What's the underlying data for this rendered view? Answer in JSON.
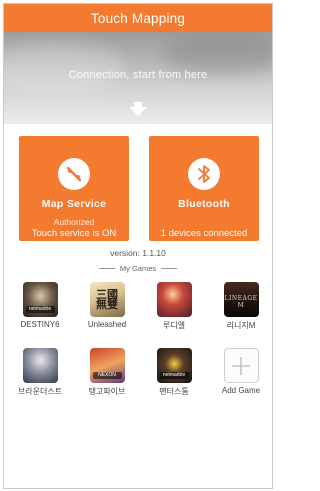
{
  "app": {
    "title": "Touch Mapping"
  },
  "hero": {
    "message": "Connection, start from here"
  },
  "tiles": {
    "map_service": {
      "name": "Map Service",
      "status": "Authorized",
      "detail": "Touch service is ON"
    },
    "bluetooth": {
      "name": "Bluetooth",
      "status": "",
      "detail": "1 devices connected"
    }
  },
  "version": "version: 1.1.10",
  "my_games": {
    "title": "My Games",
    "items": [
      {
        "label": "DESTINY6",
        "icon": "destiny6-game-icon",
        "icon_text": "netmarble"
      },
      {
        "label": "Unleashed",
        "icon": "unleashed-game-icon",
        "icon_text": "三國\n無雙"
      },
      {
        "label": "루디엘",
        "icon": "rudiel-game-icon",
        "icon_text": ""
      },
      {
        "label": "리니지M",
        "icon": "lineage-m-game-icon",
        "icon_text": "LINEAGE M"
      },
      {
        "label": "브라운더스트",
        "icon": "brown-dust-game-icon",
        "icon_text": ""
      },
      {
        "label": "탱고파이브",
        "icon": "tango-five-game-icon",
        "icon_text": "NEXON"
      },
      {
        "label": "팬타스톰",
        "icon": "fantastorm-game-icon",
        "icon_text": "netmarble"
      },
      {
        "label": "Add Game",
        "icon": "add-icon",
        "icon_text": ""
      }
    ]
  },
  "colors": {
    "accent": "#f47a30",
    "tile_text": "#ffffff",
    "hero_text": "#ffffff"
  }
}
